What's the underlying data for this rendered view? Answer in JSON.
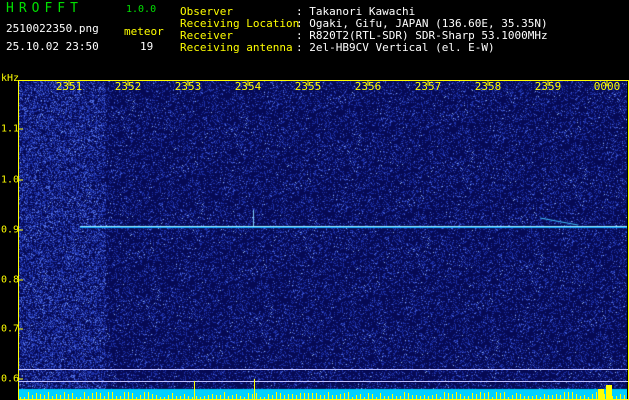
{
  "app": {
    "title": "HROFFT",
    "version": "1.0.0"
  },
  "file": {
    "name": "2510022350.png",
    "datetime": "25.10.02 23:50"
  },
  "meteor": {
    "label": "meteor",
    "count": "19"
  },
  "header": {
    "rows": [
      {
        "label": "Observer",
        "value": ": Takanori Kawachi"
      },
      {
        "label": "Receiving Location",
        "value": ": Ogaki, Gifu, JAPAN (136.60E, 35.35N)"
      },
      {
        "label": "Receiver",
        "value": ": R820T2(RTL-SDR) SDR-Sharp 53.1000MHz"
      },
      {
        "label": "Receiving antenna",
        "value": ": 2el-HB9CV Vertical (el. E-W)"
      }
    ]
  },
  "axes": {
    "y_unit": "kHz",
    "x_ticks": [
      "2351",
      "2352",
      "2353",
      "2354",
      "2355",
      "2356",
      "2357",
      "2358",
      "2359",
      "0000"
    ],
    "y_ticks": [
      "1.1",
      "1.0",
      "0.9",
      "0.8",
      "0.7",
      "0.6"
    ]
  },
  "colors": {
    "label_yellow": "#ffff00",
    "title_green": "#00e000",
    "background_blue": "#050a5a",
    "signal_cyan": "#00ffff"
  }
}
